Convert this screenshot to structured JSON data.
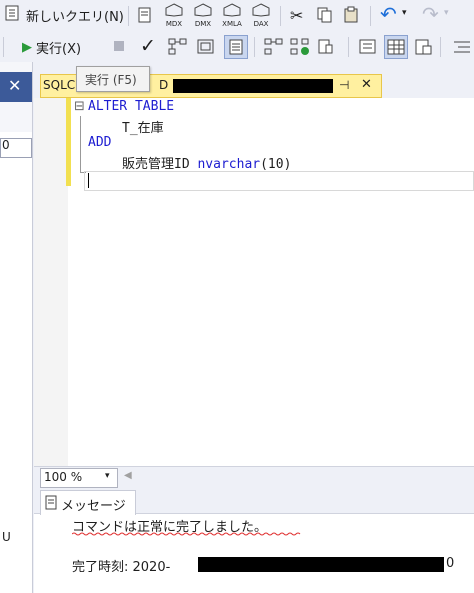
{
  "toolbar1": {
    "new_query_label": "新しいクエリ(N)",
    "mdx": "MDX",
    "dmx": "DMX",
    "xmla": "XMLA",
    "dax": "DAX"
  },
  "toolbar2": {
    "execute_label": "実行(X)"
  },
  "tooltip": {
    "text": "実行 (F5)"
  },
  "tab": {
    "title_start": "SQLC",
    "title_mid": "D",
    "pin": "⊣",
    "close": "✕"
  },
  "left_panel": {
    "close": "✕",
    "item_a": "0",
    "item_b": "U"
  },
  "editor": {
    "lines": [
      {
        "collapse": "⊟",
        "text_kw": "ALTER TABLE"
      },
      {
        "text": "T_在庫"
      },
      {
        "text_kw": "ADD"
      },
      {
        "text": "販売管理ID ",
        "text_type": "nvarchar",
        "text_rest": "(10)"
      }
    ]
  },
  "zoom": {
    "value": "100 %"
  },
  "results": {
    "tab_label": "メッセージ",
    "message": "コマンドは正常に完了しました。",
    "completion_label": "完了時刻: 2020-",
    "completion_tail": "0"
  },
  "colors": {
    "keyword": "#1d1dd1",
    "tab_bg": "#fff0a0",
    "squiggle": "#e03030",
    "highlight_bar": "#f2e050"
  }
}
